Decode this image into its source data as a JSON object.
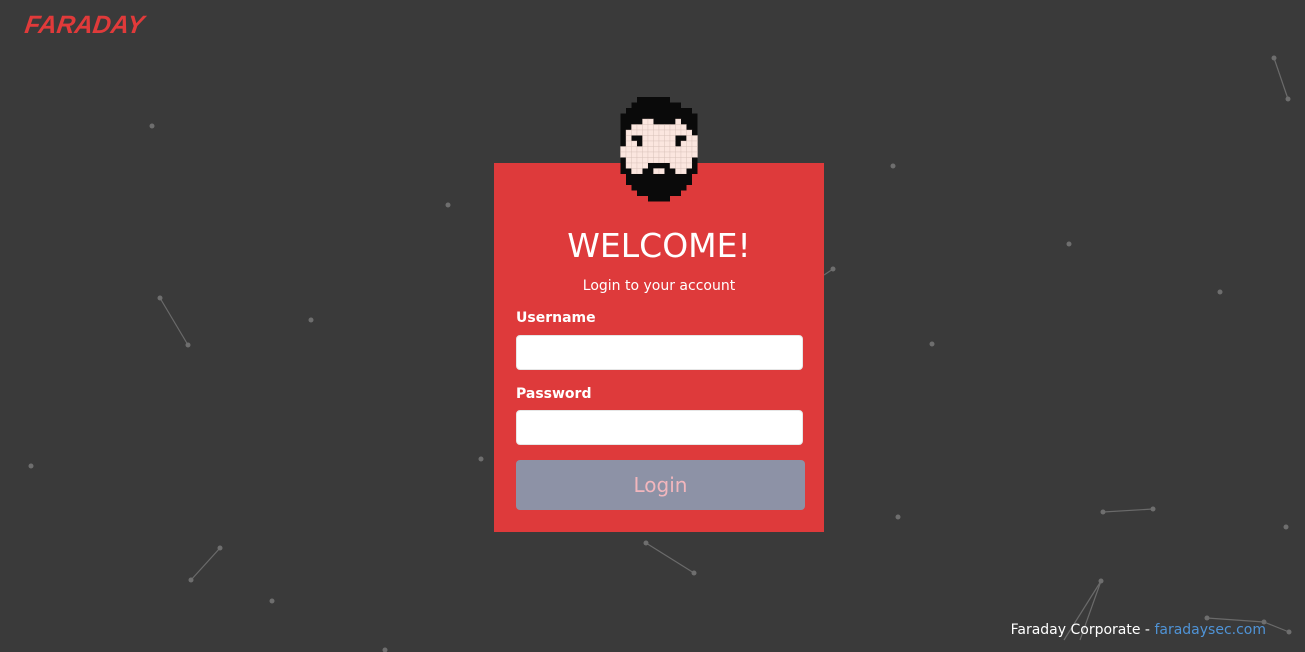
{
  "header": {
    "logo_text": "FARADAY"
  },
  "login": {
    "title": "WELCOME!",
    "subtitle": "Login to your account",
    "username_label": "Username",
    "username_value": "",
    "password_label": "Password",
    "password_value": "",
    "button_label": "Login"
  },
  "footer": {
    "company": "Faraday Corporate -",
    "link": "faradaysec.com"
  },
  "colors": {
    "background": "#3a3a3a",
    "card": "#de3a3b",
    "brand": "#e03a3a",
    "button": "#8d92a6",
    "button_text": "#f2b6bd",
    "link": "#4f93d6"
  },
  "icons": {
    "avatar": "pixel-bearded-man-avatar"
  }
}
